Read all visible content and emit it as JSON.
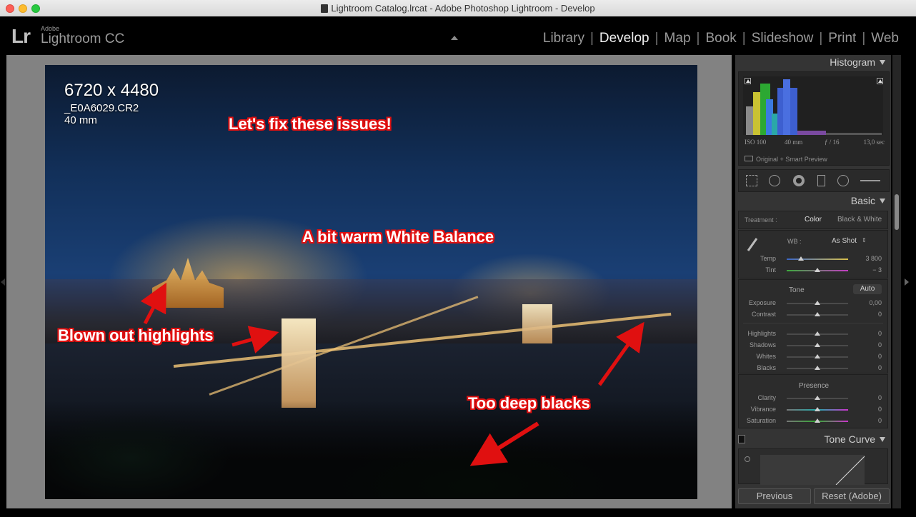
{
  "window": {
    "title": "Lightroom Catalog.lrcat - Adobe Photoshop Lightroom - Develop"
  },
  "brand": {
    "logo": "Lr",
    "company": "Adobe",
    "product": "Lightroom CC"
  },
  "modules": [
    {
      "label": "Library"
    },
    {
      "label": "Develop",
      "active": true
    },
    {
      "label": "Map"
    },
    {
      "label": "Book"
    },
    {
      "label": "Slideshow"
    },
    {
      "label": "Print"
    },
    {
      "label": "Web"
    }
  ],
  "photo_info": {
    "dimensions": "6720 x 4480",
    "filename": "_E0A6029.CR2",
    "focal": "40 mm"
  },
  "annotations": {
    "fix": "Let's fix these issues!",
    "wb": "A bit warm White Balance",
    "highlights": "Blown out highlights",
    "blacks": "Too deep blacks"
  },
  "histogram": {
    "title": "Histogram",
    "iso": "ISO 100",
    "focal": "40 mm",
    "aperture": "ƒ / 16",
    "shutter": "13,0 sec",
    "preview": "Original + Smart Preview"
  },
  "basic": {
    "title": "Basic",
    "treatment_label": "Treatment :",
    "treatment_color": "Color",
    "treatment_bw": "Black & White",
    "wb_label": "WB :",
    "wb_value": "As Shot",
    "temp_label": "Temp",
    "temp_value": "3 800",
    "tint_label": "Tint",
    "tint_value": "− 3",
    "tone_label": "Tone",
    "auto_label": "Auto",
    "exposure_label": "Exposure",
    "exposure_value": "0,00",
    "contrast_label": "Contrast",
    "contrast_value": "0",
    "highlights_label": "Highlights",
    "highlights_value": "0",
    "shadows_label": "Shadows",
    "shadows_value": "0",
    "whites_label": "Whites",
    "whites_value": "0",
    "blacks_label": "Blacks",
    "blacks_value": "0",
    "presence_label": "Presence",
    "clarity_label": "Clarity",
    "clarity_value": "0",
    "vibrance_label": "Vibrance",
    "vibrance_value": "0",
    "saturation_label": "Saturation",
    "saturation_value": "0"
  },
  "tonecurve": {
    "title": "Tone Curve"
  },
  "buttons": {
    "previous": "Previous",
    "reset": "Reset (Adobe)"
  },
  "colors": {
    "annotation_red": "#e01010",
    "panel_bg": "#343434",
    "active_module": "#f0f0f0"
  },
  "icons": [
    "crop-icon",
    "spot-removal-icon",
    "red-eye-icon",
    "graduated-filter-icon",
    "radial-filter-icon",
    "adjustment-brush-icon",
    "eyedropper-icon"
  ]
}
